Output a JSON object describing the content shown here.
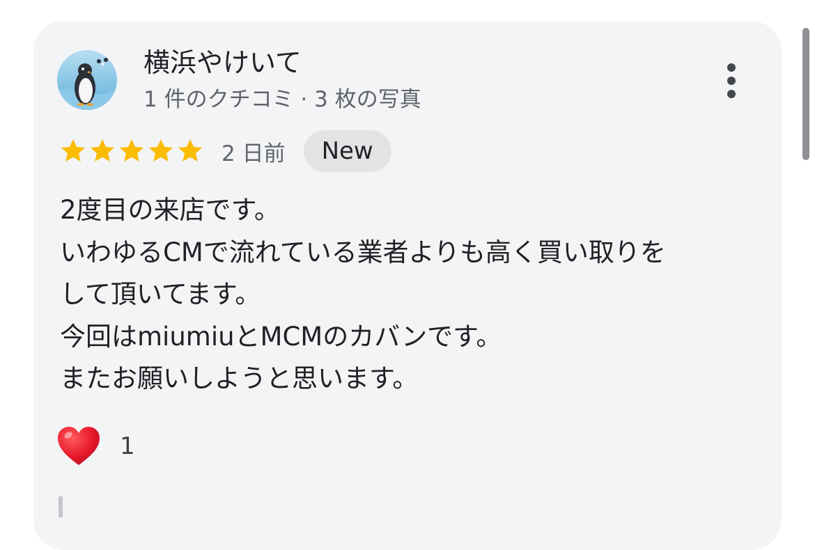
{
  "review": {
    "reviewer": {
      "name": "横浜やけいて",
      "meta": "1 件のクチコミ · 3 枚の写真",
      "avatar_icon": "penguin-avatar-icon"
    },
    "rating": 5,
    "rating_max": 5,
    "date": "2 日前",
    "badge": "New",
    "text_lines": [
      "2度目の来店です。",
      "いわゆるCMで流れている業者よりも高く買い取りを",
      "して頂いてます。",
      "今回はmiumiuとMCMのカバンです。",
      "またお願いしようと思います。"
    ],
    "reaction": {
      "icon": "heart-icon",
      "count": "1"
    }
  },
  "colors": {
    "card_background": "#f3f4f6",
    "star": "#fbbc04",
    "badge_background": "#e2e3e5",
    "heart": "#e8192c"
  }
}
